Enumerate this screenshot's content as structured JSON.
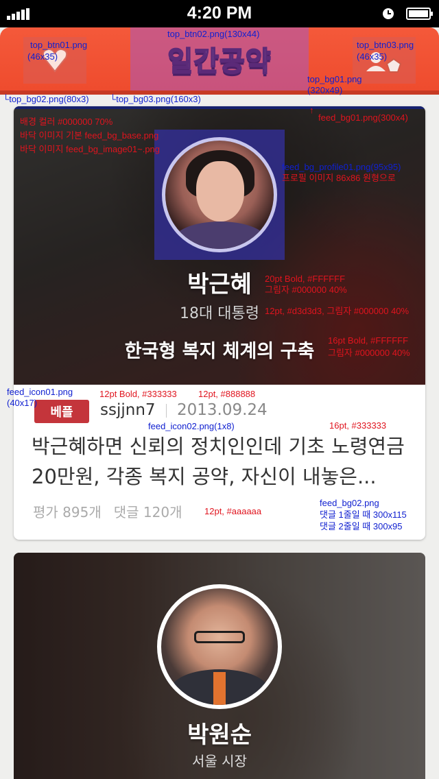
{
  "status_bar": {
    "time": "4:20 PM",
    "signal_icon": "signal-bars-icon",
    "alarm_icon": "alarm-clock-icon",
    "battery_icon": "battery-icon"
  },
  "header": {
    "title": "일간공약",
    "left_button_icon": "heart-shield-icon",
    "right_button_icon": "pentagon-user-icon",
    "colors": {
      "background": "#f0502f",
      "bottom_line": "#c73a24"
    }
  },
  "annotations": {
    "top_btn01": {
      "file": "top_btn01.png",
      "size": "(46x35)"
    },
    "top_btn02": "top_btn02.png(130x44)",
    "top_btn03": {
      "file": "top_btn03.png",
      "size": "(46x35)"
    },
    "top_bg01": {
      "file": "top_bg01.png",
      "size": "(320x49)"
    },
    "top_bg02": "top_bg02.png(80x3)",
    "top_bg03": "top_bg03.png(160x3)",
    "feed_bg01": "feed_bg01.png(300x4)",
    "banner_notes": [
      "배경 컬러 #000000 70%",
      "바닥 이미지 기본 feed_bg_base.png",
      "바닥 이미지 feed_bg_image01~.png"
    ],
    "profile": {
      "file": "feed_bg_profile01.png(95x95)",
      "note": "프로필 이미지 86x86 원형으로"
    },
    "name_style": {
      "font": "20pt Bold, #FFFFFF",
      "shadow": "그림자 #000000 40%"
    },
    "role_style": "12pt, #d3d3d3, 그림자 #000000 40%",
    "pledge_style": {
      "font": "16pt Bold, #FFFFFF",
      "shadow": "그림자 #000000 40%"
    },
    "feed_icon01": {
      "file": "feed_icon01.png",
      "size": "(40x17)"
    },
    "user_style": "12pt Bold, #333333",
    "date_style": "12pt, #888888",
    "feed_icon02": "feed_icon02.png(1x8)",
    "body_style": "16pt, #333333",
    "stats_style": "12pt, #aaaaaa",
    "feed_bg02": {
      "file": "feed_bg02.png",
      "line1": "댓글 1줄일 때 300x115",
      "line2": "댓글 2줄일 때 300x95"
    }
  },
  "feed": [
    {
      "name": "박근혜",
      "role": "18대 대통령",
      "pledge": "한국형 복지 체계의 구축",
      "post": {
        "badge": "베플",
        "user": "ssjjnn7",
        "date": "2013.09.24",
        "body": "박근혜하면 신뢰의 정치인인데 기초 노령연금20만원, 각종 복지 공약, 자신이 내놓은...",
        "rating": "평가 895개",
        "comments": "댓글 120개"
      }
    },
    {
      "name": "박원순",
      "role": "서울 시장"
    }
  ]
}
